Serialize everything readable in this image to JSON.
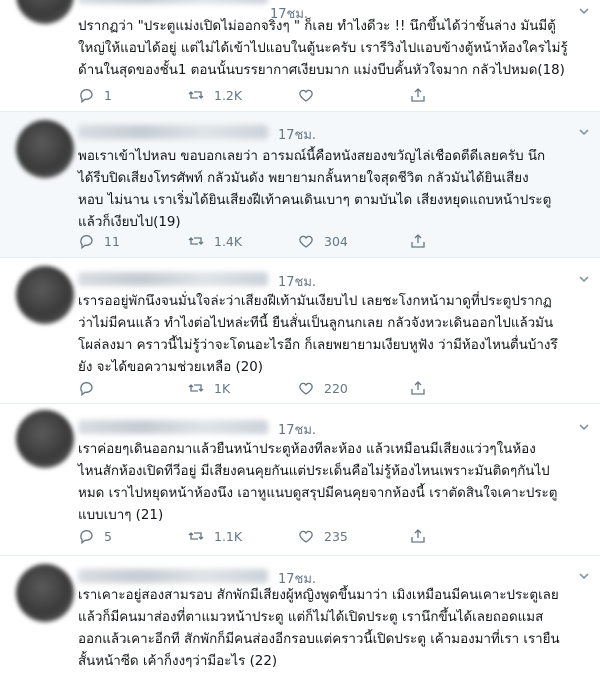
{
  "tweets": [
    {
      "time": "",
      "text": "ปรากฏว่า \"ประตูแม่งเปิดไม่ออกจริงๆ \" ก็เลย ทำไงดีวะ !! นึกขึ้นได้ว่าชั้นล่าง มันมีตู้\nใหญ่ให้แอบได้อยู่ แต่ไม่ได้เข้าไปแอบในตู้นะครับ เรารีวิงไปแอบข้างตู้หน้าห้องใครไม่รู้\nด้านในสุดของชั้น1 ตอนนั้นบรรยากาศเงียบมาก แม่งบีบคั้นหัวใจมาก กลัวไปหมด(18)",
      "reply": "1",
      "retweet": "1.2K",
      "like": "",
      "share": ""
    },
    {
      "time": "17ชม.",
      "text": "พอเราเข้าไปหลบ ขอบอกเลยว่า อารมณ์นี้คือหนังสยองขวัญไล่เชือดตีดีเลยครับ นึก\nได้รีบปิดเสียงโทรศัพท์ กลัวมันดัง พยายามกลั้นหายใจสุดชีวิต กลัวมันได้ยินเสียง\nหอบ ไม่นาน เราเริ่มได้ยินเสียงฝีเท้าคนเดินเบาๆ ตามบันได เสียงหยุดแถบหน้าประตู\nแล้วก็เงียบไป(19)",
      "reply": "11",
      "retweet": "1.4K",
      "like": "304",
      "share": ""
    },
    {
      "time": "17ชม.",
      "text": "เรารออยู่พักนึงจนมั่นใจล่ะว่าเสียงฝีเท้ามันเงียบไป เลยชะโงกหน้ามาดูที่ประตูปรากฏ\nว่าไม่มีคนแล้ว ทำไงต่อไปหล่ะทีนี้ ยืนสั่นเป็นลูกนกเลย กลัวจังหวะเดินออกไปแล้วมัน\nโผล่ลงมา คราวนี้ไม่รู้ว่าจะโดนอะไรอีก ก็เลยพยายามเงียบหูฟัง ว่ามีห้องไหนตื่นบ้างรึ\nยัง จะได้ขอความช่วยเหลือ (20)",
      "reply": "",
      "retweet": "1K",
      "like": "220",
      "share": ""
    },
    {
      "time": "17ชม.",
      "text": "เราค่อยๆเดินออกมาแล้วยืนหน้าประตูห้องทีละห้อง แล้วเหมือนมีเสียงแว่วๆในห้อง\nไหนสักห้องเปิดทีวีอยู่ มีเสียงคนคุยกันแต่ประเด็นคือไม่รู้ห้องไหนเพราะมันติดๆกันไป\nหมด เราไปหยุดหน้าห้องนึง เอาหูแนบดูสรุปมีคนคุยจากห้องนี้ เราตัดสินใจเคาะประตู\nแบบเบาๆ (21)",
      "reply": "5",
      "retweet": "1.1K",
      "like": "235",
      "share": ""
    },
    {
      "time": "17ชม.",
      "text": "เราเคาะอยู่สองสามรอบ สักพักมีเสียงผู้หญิงพูดขึ้นมาว่า เมิงเหมือนมีคนเคาะประตูเลย\nแล้วก็มีคนมาส่องที่ตาแมวหน้าประตู แต่ก็ไม่ได้เปิดประตู เรานึกขึ้นได้เลยถอดแมส\nออกแล้วเคาะอีกที สักพักก็มีคนส่องอีกรอบแต่คราวนี้เปิดประตู เค้ามองมาที่เรา เรายืน\nสั้นหน้าซีด เค้าก็งงๆว่ามีอะไร (22)",
      "reply": "",
      "retweet": "",
      "like": "",
      "share": ""
    }
  ],
  "icons": {
    "reply": "reply-icon",
    "retweet": "retweet-icon",
    "like": "heart-icon",
    "share": "share-icon",
    "caret": "chevron-down-icon"
  },
  "colors": {
    "text": "#14171a",
    "muted": "#657786",
    "divider": "#e6ecf0",
    "alt_background": "#f5f8fa"
  },
  "top_time": "17ชม."
}
